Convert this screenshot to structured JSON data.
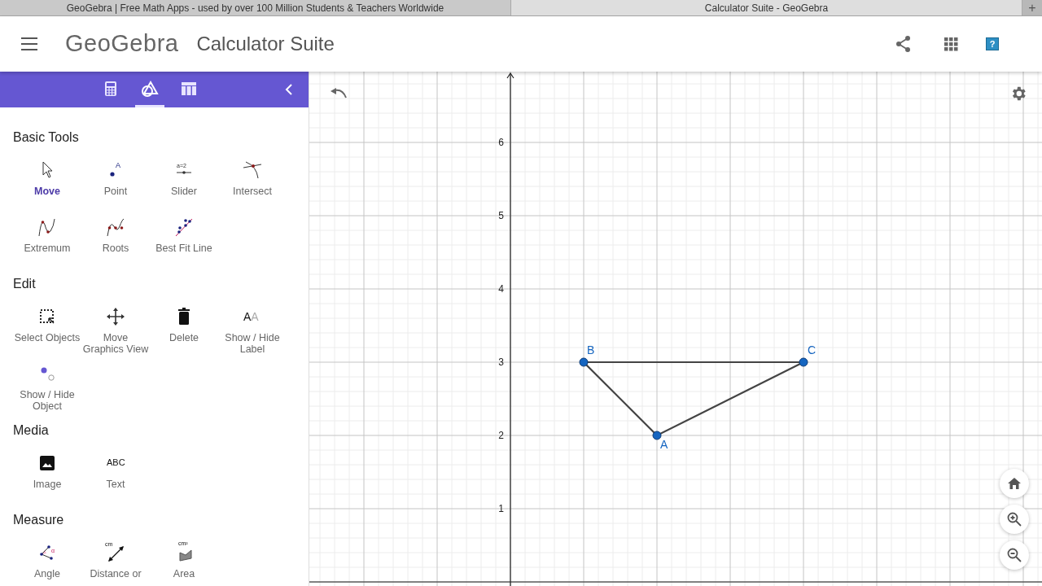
{
  "browser_tabs": [
    {
      "title": "GeoGebra | Free Math Apps - used by over 100 Million Students & Teachers Worldwide",
      "selected": false
    },
    {
      "title": "Calculator Suite - GeoGebra",
      "selected": true
    }
  ],
  "new_tab_button": "+",
  "header": {
    "logo": "GeoGebra",
    "title": "Calculator Suite",
    "help_button": "?"
  },
  "panel_tabs": [
    {
      "kind": "calculator",
      "selected": false
    },
    {
      "kind": "geometry",
      "selected": true
    },
    {
      "kind": "table",
      "selected": false
    }
  ],
  "sections": [
    {
      "title": "Basic Tools",
      "tools": [
        {
          "kind": "move",
          "label": "Move",
          "selected": true
        },
        {
          "kind": "point",
          "label": "Point",
          "selected": false,
          "icon_text": "A"
        },
        {
          "kind": "slider",
          "label": "Slider",
          "selected": false,
          "icon_text": "a=2"
        },
        {
          "kind": "intersect",
          "label": "Intersect",
          "selected": false
        },
        {
          "kind": "extremum",
          "label": "Extremum",
          "selected": false
        },
        {
          "kind": "roots",
          "label": "Roots",
          "selected": false
        },
        {
          "kind": "bestfit",
          "label": "Best Fit Line",
          "selected": false
        }
      ]
    },
    {
      "title": "Edit",
      "tools": [
        {
          "kind": "select",
          "label": "Select Objects",
          "selected": false
        },
        {
          "kind": "pan",
          "label": "Move Graphics View",
          "selected": false
        },
        {
          "kind": "delete",
          "label": "Delete",
          "selected": false
        },
        {
          "kind": "label",
          "label": "Show / Hide Label",
          "selected": false,
          "icon_text": "AA"
        },
        {
          "kind": "showhide",
          "label": "Show / Hide Object",
          "selected": false
        }
      ]
    },
    {
      "title": "Media",
      "tools": [
        {
          "kind": "image",
          "label": "Image",
          "selected": false
        },
        {
          "kind": "text",
          "label": "Text",
          "selected": false,
          "icon_text": "ABC"
        }
      ]
    },
    {
      "title": "Measure",
      "tools": [
        {
          "kind": "angle",
          "label": "Angle",
          "selected": false,
          "icon_text": "α"
        },
        {
          "kind": "distance",
          "label": "Distance or",
          "selected": false,
          "icon_text": "cm"
        },
        {
          "kind": "area",
          "label": "Area",
          "selected": false,
          "icon_text": "cm²"
        }
      ]
    }
  ],
  "graphics": {
    "y_axis_labels": [
      "6",
      "5",
      "4",
      "3",
      "2",
      "1"
    ],
    "points": [
      {
        "label": "A"
      },
      {
        "label": "B"
      },
      {
        "label": "C"
      }
    ]
  }
}
